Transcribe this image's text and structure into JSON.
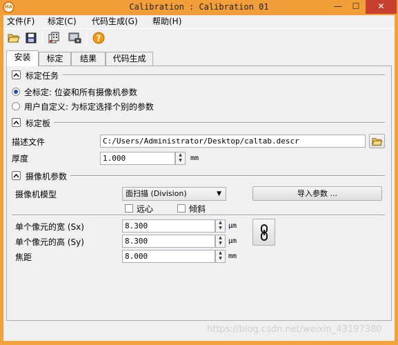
{
  "window": {
    "title": "Calibration : Calibration 01",
    "app_icon_text": "HA",
    "minimize_symbol": "—",
    "maximize_symbol": "☐",
    "close_symbol": "✕"
  },
  "menu": {
    "items": [
      {
        "label": "文件(F)"
      },
      {
        "label": "标定(C)"
      },
      {
        "label": "代码生成(G)"
      },
      {
        "label": "帮助(H)"
      }
    ]
  },
  "toolbar": {
    "buttons": [
      {
        "icon": "open-folder-icon"
      },
      {
        "icon": "save-icon"
      },
      {
        "icon": "calibration-plate-icon"
      },
      {
        "icon": "camera-setup-icon"
      },
      {
        "icon": "help-icon"
      }
    ]
  },
  "tabs": [
    {
      "label": "安装",
      "active": true
    },
    {
      "label": "标定",
      "active": false
    },
    {
      "label": "结果",
      "active": false
    },
    {
      "label": "代码生成",
      "active": false
    }
  ],
  "calibration_task": {
    "title": "标定任务",
    "options": [
      {
        "label": "全标定: 位姿和所有摄像机参数",
        "selected": true
      },
      {
        "label": "用户自定义: 为标定选择个别的参数",
        "selected": false
      }
    ]
  },
  "calibration_plate": {
    "title": "标定板",
    "description_label": "描述文件",
    "description_value": "C:/Users/Administrator/Desktop/caltab.descr",
    "thickness_label": "厚度",
    "thickness_value": "1.000",
    "thickness_unit": "mm"
  },
  "camera_params": {
    "title": "摄像机参数",
    "model_label": "摄像机模型",
    "model_value": "面扫描 (Division)",
    "import_button": "导入参数 ...",
    "telecentric_label": "远心",
    "tilt_label": "倾斜",
    "sx_label": "单个像元的宽 (Sx)",
    "sx_value": "8.300",
    "sx_unit": "μm",
    "sy_label": "单个像元的高 (Sy)",
    "sy_value": "8.300",
    "sy_unit": "μm",
    "focal_label": "焦距",
    "focal_value": "8.000",
    "focal_unit": "mm"
  },
  "watermark": "https://blog.csdn.net/weixin_43197380"
}
